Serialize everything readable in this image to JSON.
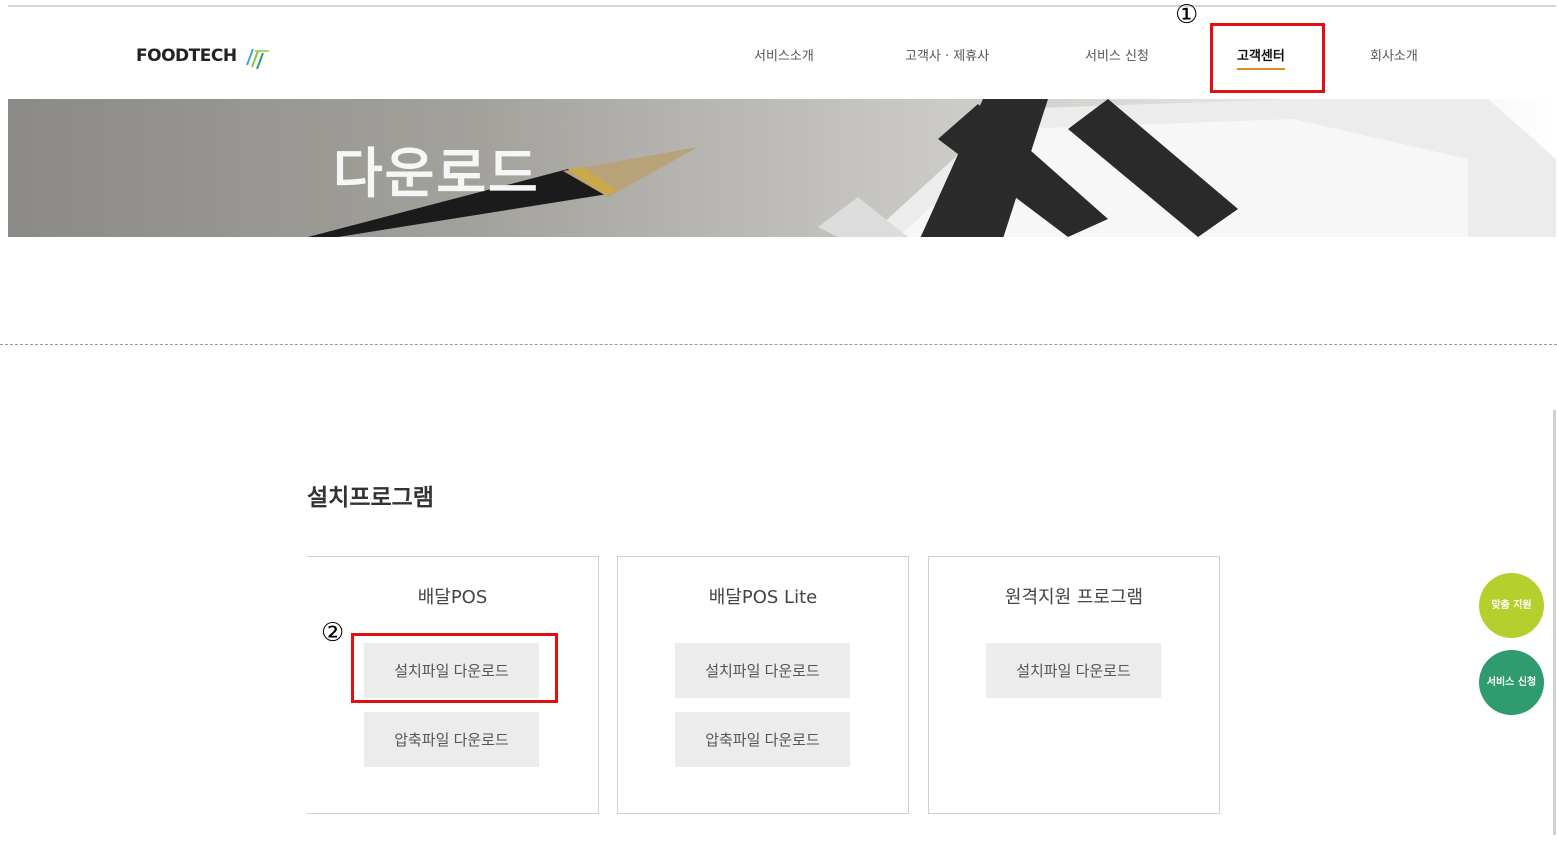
{
  "header": {
    "logo_text": "FOODTECH",
    "nav": [
      {
        "label": "서비스소개"
      },
      {
        "label": "고객사 · 제휴사"
      },
      {
        "label": "서비스 신청"
      },
      {
        "label": "고객센터"
      },
      {
        "label": "회사소개"
      }
    ],
    "active_index": 3
  },
  "annotations": {
    "step1": "①",
    "step2": "②"
  },
  "banner": {
    "title": "다운로드"
  },
  "main": {
    "section_title": "설치프로그램",
    "cards": [
      {
        "title": "배달POS",
        "buttons": [
          "설치파일 다운로드",
          "압축파일 다운로드"
        ]
      },
      {
        "title": "배달POS Lite",
        "buttons": [
          "설치파일 다운로드",
          "압축파일 다운로드"
        ]
      },
      {
        "title": "원격지원 프로그램",
        "buttons": [
          "설치파일 다운로드"
        ]
      }
    ]
  },
  "floating": {
    "btn1_label": "맞춤 지원",
    "btn2_label": "서비스 신청",
    "btn1_color": "#b5cf2d",
    "btn2_color": "#2f9b6f"
  },
  "colors": {
    "highlight": "#e01010",
    "nav_underline": "#e28a2a"
  }
}
